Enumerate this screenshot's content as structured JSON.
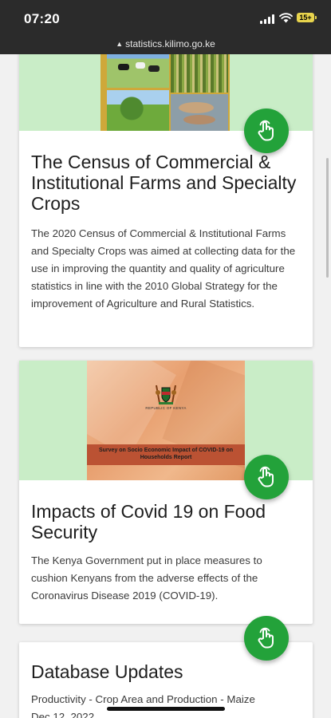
{
  "status_bar": {
    "time": "07:20",
    "battery": "15+"
  },
  "browser": {
    "url": "statistics.kilimo.go.ke"
  },
  "cards": [
    {
      "title": "The Census of Commercial & Institutional Farms and Specialty Crops",
      "description": "The 2020 Census of Commercial & Institutional Farms and Specialty Crops was aimed at collecting data for the use in improving the quantity and quality of agriculture statistics in line with the 2010 Global Strategy for the improvement of Agriculture and Rural Statistics."
    },
    {
      "title": "Impacts of Covid 19 on Food Security",
      "description": "The Kenya Government put in place measures to cushion Kenyans from the adverse effects of the Coronavirus Disease 2019 (COVID-19).",
      "image": {
        "seal_text": "REPUBLIC OF KENYA",
        "report_title": "Survey on Socio Economic Impact of COVID-19 on Households Report"
      }
    },
    {
      "title": "Database Updates",
      "items": [
        {
          "label": "Productivity - Crop Area and Production - Maize",
          "date": "Dec 12, 2022"
        }
      ]
    }
  ],
  "colors": {
    "hero_bg": "#c9edc7",
    "fab": "#23a23a",
    "report_orange": "#e8a070"
  },
  "icons": {
    "fab": "touch-icon",
    "lock": "lock-icon"
  }
}
